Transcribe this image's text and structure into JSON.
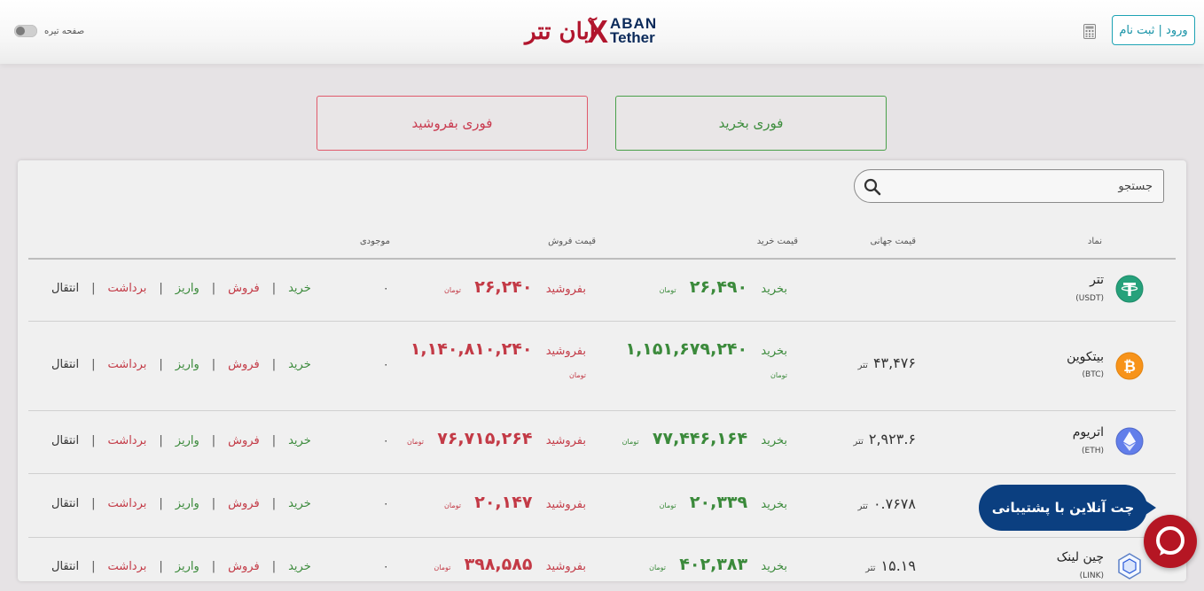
{
  "header": {
    "dark_mode_label": "صفحه تیره",
    "logo_fa": "آبان تتر",
    "logo_x": "X",
    "logo_aban": "ABAN",
    "logo_tether": "Tether",
    "login_label": "ورود | ثبت نام"
  },
  "actions": {
    "buy_now": "فوری بخرید",
    "sell_now": "فوری بفروشید"
  },
  "search": {
    "placeholder": "جستجو"
  },
  "table": {
    "headers": {
      "symbol": "نماد",
      "world_price": "قیمت جهانی",
      "buy_price": "قیمت خرید",
      "sell_price": "قیمت فروش",
      "balance": "موجودی"
    },
    "labels": {
      "buy": "بخرید",
      "sell": "بفروشید",
      "toman": "تومان",
      "tether_unit": "تتر",
      "act_transfer": "انتقال",
      "act_withdraw": "برداشت",
      "act_deposit": "واریز",
      "act_sell": "فروش",
      "act_buy": "خرید"
    },
    "rows": [
      {
        "name": "تتر",
        "symbol": "(USDT)",
        "world": "",
        "buy": "۲۶,۴۹۰",
        "sell": "۲۶,۲۴۰",
        "balance": "۰",
        "icon": "tether-icon",
        "color": "#26a17b"
      },
      {
        "name": "بیتکوین",
        "symbol": "(BTC)",
        "world": "۴۳,۴۷۶",
        "buy": "۱,۱۵۱,۶۷۹,۲۴۰",
        "sell": "۱,۱۴۰,۸۱۰,۲۴۰",
        "balance": "۰",
        "icon": "bitcoin-icon",
        "color": "#f7931a"
      },
      {
        "name": "اتریوم",
        "symbol": "(ETH)",
        "world": "۲,۹۲۳.۶",
        "buy": "۷۷,۴۴۶,۱۶۴",
        "sell": "۷۶,۷۱۵,۲۶۴",
        "balance": "۰",
        "icon": "ethereum-icon",
        "color": "#627eea"
      },
      {
        "name": "",
        "symbol": "",
        "world": "۰.۷۶۷۸",
        "buy": "۲۰,۳۳۹",
        "sell": "۲۰,۱۴۷",
        "balance": "۰",
        "icon": "",
        "color": ""
      },
      {
        "name": "چین لینک",
        "symbol": "(LINK)",
        "world": "۱۵.۱۹",
        "buy": "۴۰۲,۳۸۳",
        "sell": "۳۹۸,۵۸۵",
        "balance": "۰",
        "icon": "chainlink-icon",
        "color": "#2a5ada"
      }
    ]
  },
  "chat": {
    "label": "چت آنلاین با پشتیبانی"
  }
}
